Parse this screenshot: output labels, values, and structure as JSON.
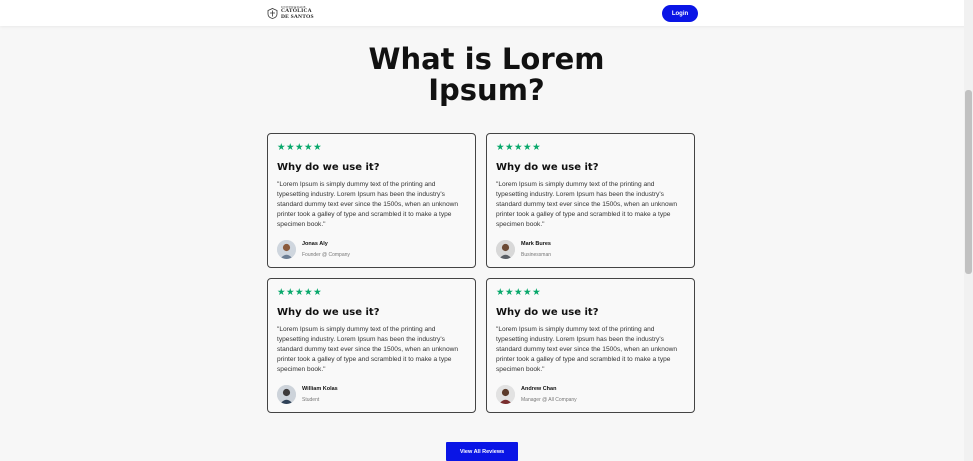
{
  "header": {
    "logo_small_text": "UNIVERSIDADE",
    "logo_name_line1": "CATÓLICA",
    "logo_name_line2": "DE SANTOS",
    "login_label": "Login"
  },
  "main": {
    "title_line1": "What is Lorem",
    "title_line2": "Ipsum?"
  },
  "testimonials": [
    {
      "stars": "★★★★★",
      "heading": "Why do we use it?",
      "quote": "\"Lorem Ipsum is simply dummy text of the printing and typesetting industry. Lorem Ipsum has been the industry's standard dummy text ever since the 1500s, when an unknown printer took a galley of type and scrambled it to make a type specimen book.\"",
      "name": "Jonas Aly",
      "role": "Founder @ Company",
      "rating": 5
    },
    {
      "stars": "★★★★★",
      "heading": "Why do we use it?",
      "quote": "\"Lorem Ipsum is simply dummy text of the printing and typesetting industry. Lorem Ipsum has been the industry's standard dummy text ever since the 1500s, when an unknown printer took a galley of type and scrambled it to make a type specimen book.\"",
      "name": "Mark Bures",
      "role": "Businessman",
      "rating": 5
    },
    {
      "stars": "★★★★★",
      "heading": "Why do we use it?",
      "quote": "\"Lorem Ipsum is simply dummy text of the printing and typesetting industry. Lorem Ipsum has been the industry's standard dummy text ever since the 1500s, when an unknown printer took a galley of type and scrambled it to make a type specimen book.\"",
      "name": "William Kolas",
      "role": "Student",
      "rating": 5
    },
    {
      "stars": "★★★★★",
      "heading": "Why do we use it?",
      "quote": "\"Lorem Ipsum is simply dummy text of the printing and typesetting industry. Lorem Ipsum has been the industry's standard dummy text ever since the 1500s, when an unknown printer took a galley of type and scrambled it to make a type specimen book.\"",
      "name": "Andrew Chan",
      "role": "Manager @ All Company",
      "rating": 5
    }
  ],
  "footer": {
    "view_all_label": "View All Reviews"
  },
  "colors": {
    "accent": "#0a15e6",
    "star": "#08a86b",
    "background": "#f7f7f7",
    "card_border": "#444444"
  },
  "icons": {
    "logo": "university-crest-icon",
    "avatar": "user-photo-icon",
    "star": "star-icon"
  }
}
